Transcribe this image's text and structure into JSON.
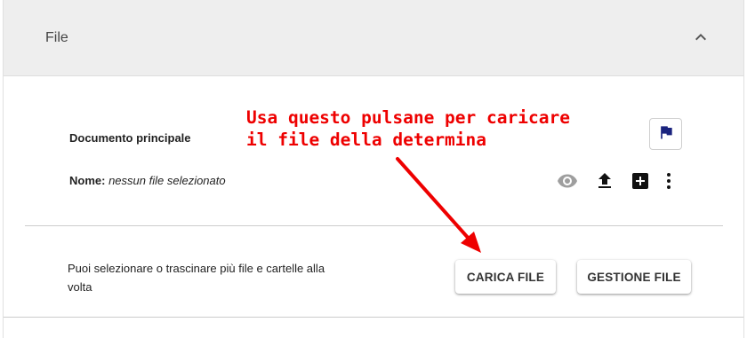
{
  "panel": {
    "title": "File"
  },
  "document": {
    "title": "Documento principale",
    "name_label": "Nome:",
    "name_value": "nessun file selezionato"
  },
  "icons": {
    "collapse": "chevron-up-icon",
    "flag": "flag-icon",
    "view": "eye-icon",
    "upload": "upload-icon",
    "add": "add-box-icon",
    "more": "more-vert-icon"
  },
  "upload_area": {
    "hint": "Puoi selezionare o trascinare più file e cartelle alla volta",
    "upload_button_label": "CARICA FILE",
    "manage_button_label": "GESTIONE FILE"
  },
  "annotation": {
    "line1": "Usa questo pulsane per caricare",
    "line2": "il file della determina",
    "color": "#ee0000"
  },
  "colors": {
    "flag": "#1a237e",
    "header_bg": "#eeeeee",
    "icon_dark": "#111111",
    "icon_disabled": "#9e9e9e"
  }
}
